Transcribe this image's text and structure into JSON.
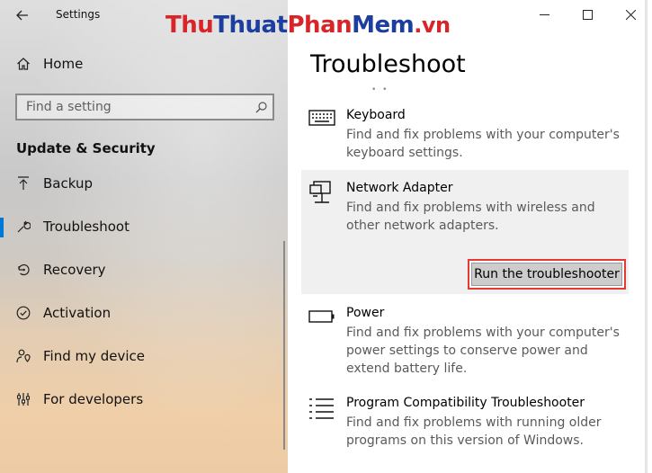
{
  "window": {
    "title": "Settings",
    "controls": [
      "minimize",
      "maximize",
      "close"
    ]
  },
  "watermark": {
    "parts": [
      "Thu",
      "Thuat",
      "Phan",
      "Mem",
      ".vn"
    ]
  },
  "sidebar": {
    "home_label": "Home",
    "search_placeholder": "Find a setting",
    "section_title": "Update & Security",
    "items": [
      {
        "label": "Backup",
        "icon": "backup-arrow-icon"
      },
      {
        "label": "Troubleshoot",
        "icon": "wrench-icon",
        "selected": true
      },
      {
        "label": "Recovery",
        "icon": "recovery-icon"
      },
      {
        "label": "Activation",
        "icon": "check-circle-icon"
      },
      {
        "label": "Find my device",
        "icon": "person-location-icon"
      },
      {
        "label": "For developers",
        "icon": "developer-tools-icon"
      }
    ]
  },
  "main": {
    "page_title": "Troubleshoot",
    "items": [
      {
        "name": "Keyboard",
        "icon": "keyboard-icon",
        "description": "Find and fix problems with your computer's keyboard settings."
      },
      {
        "name": "Network Adapter",
        "icon": "network-adapter-icon",
        "description": "Find and fix problems with wireless and other network adapters.",
        "expanded": true,
        "button_label": "Run the troubleshooter"
      },
      {
        "name": "Power",
        "icon": "battery-icon",
        "description": "Find and fix problems with your computer's power settings to conserve power and extend battery life."
      },
      {
        "name": "Program Compatibility Troubleshooter",
        "icon": "list-icon",
        "description": "Find and fix problems with running older programs on this version of Windows."
      }
    ]
  },
  "colors": {
    "accent": "#0078d7",
    "highlight_border": "#e53935",
    "button_bg": "#cccccc"
  }
}
